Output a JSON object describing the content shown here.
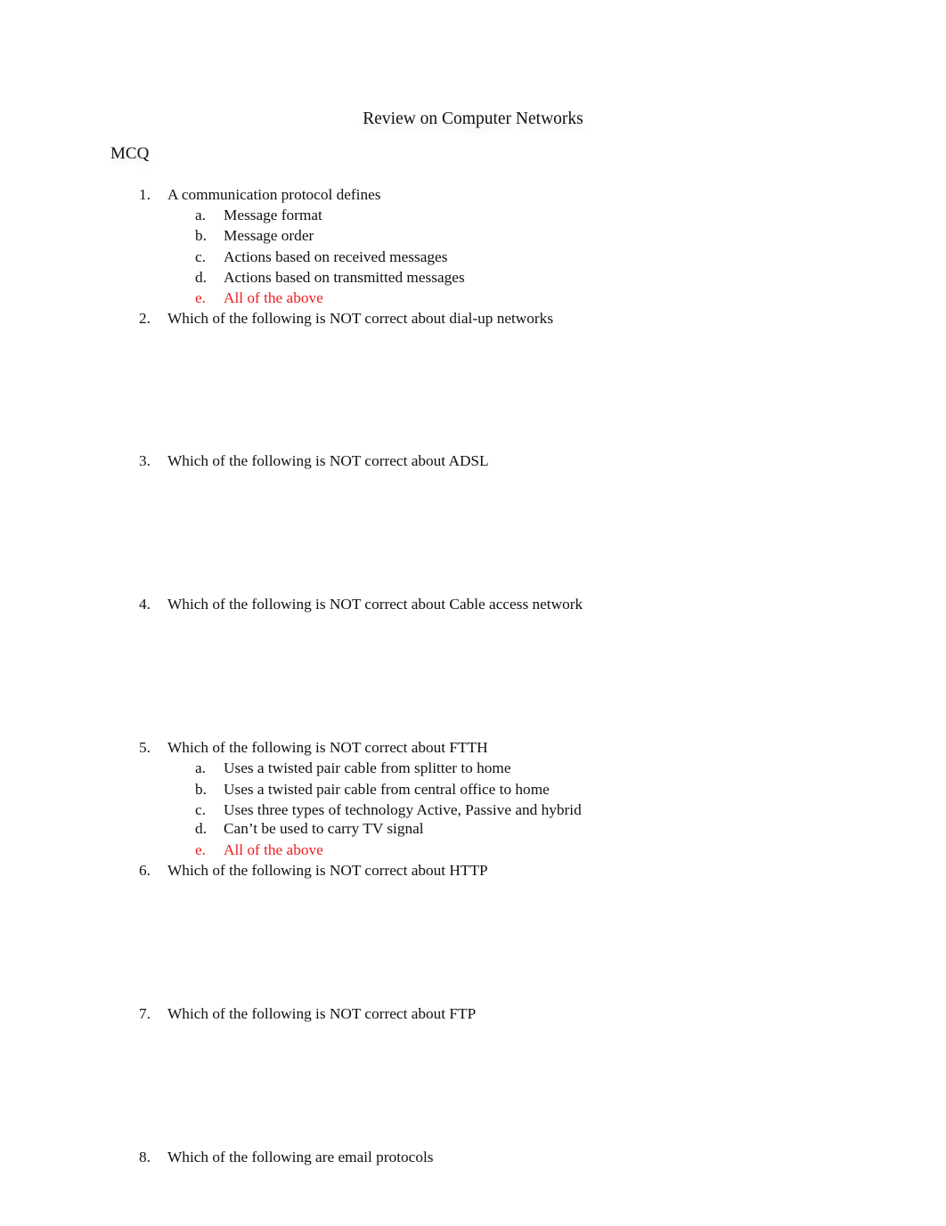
{
  "document": {
    "title": "Review on Computer Networks",
    "section": "MCQ",
    "answer_color": "#ee1c1c",
    "questions": [
      {
        "number": "1.",
        "text": "A communication protocol defines",
        "options": [
          {
            "letter": "a.",
            "text": "Message format",
            "correct": false
          },
          {
            "letter": "b.",
            "text": "Message order",
            "correct": false
          },
          {
            "letter": "c.",
            "text": "Actions based on received messages",
            "correct": false
          },
          {
            "letter": "d.",
            "text": "Actions based on transmitted messages",
            "correct": false
          },
          {
            "letter": "e.",
            "text": "All of the above",
            "correct": true
          }
        ]
      },
      {
        "number": "2.",
        "text": "Which of the following is NOT correct about dial-up networks",
        "options": []
      },
      {
        "number": "3.",
        "text": "Which of the following is NOT correct about ADSL",
        "options": []
      },
      {
        "number": "4.",
        "text": "Which of the following is NOT correct about Cable access network",
        "options": []
      },
      {
        "number": "5.",
        "text": "Which of the following is NOT correct about FTTH",
        "options": [
          {
            "letter": "a.",
            "text": "Uses a twisted pair cable from splitter to home",
            "correct": false
          },
          {
            "letter": "b.",
            "text": "Uses a twisted pair cable from central office to home",
            "correct": false
          },
          {
            "letter": "c.",
            "text": "Uses three types of technology Active, Passive and hybrid",
            "correct": false
          },
          {
            "letter": "d.",
            "text": "Can’t be used to carry TV signal",
            "correct": false
          },
          {
            "letter": "e.",
            "text": "All of the above",
            "correct": true
          }
        ]
      },
      {
        "number": "6.",
        "text": "Which of the following is NOT correct about HTTP",
        "options": []
      },
      {
        "number": "7.",
        "text": "Which of the following is NOT correct about FTP",
        "options": []
      },
      {
        "number": "8.",
        "text": "Which of the following are email protocols",
        "options": []
      }
    ]
  }
}
